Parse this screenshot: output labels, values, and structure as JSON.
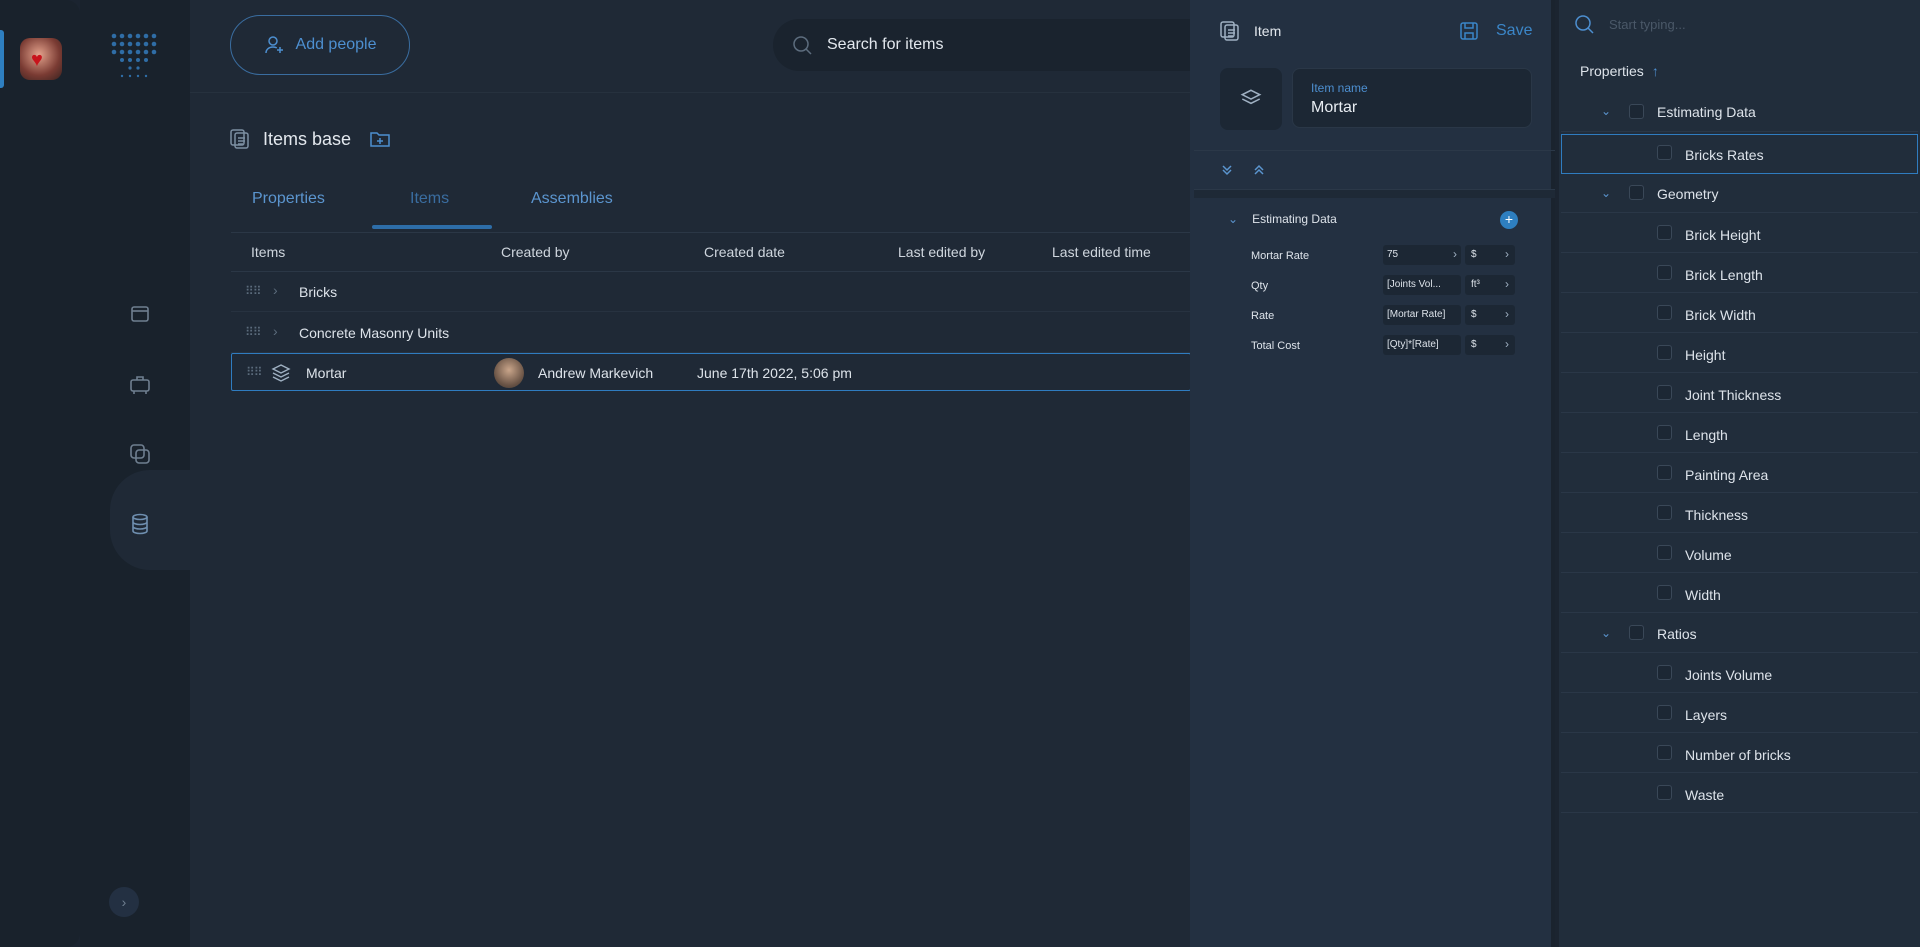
{
  "topbar": {
    "add_people": "Add people",
    "search_placeholder": "Search for items"
  },
  "page": {
    "title": "Items base"
  },
  "tabs": [
    "Properties",
    "Items",
    "Assemblies"
  ],
  "table": {
    "columns": [
      "Items",
      "Created by",
      "Created date",
      "Last edited by",
      "Last edited time"
    ],
    "rows": [
      {
        "name": "Bricks",
        "created_by": "",
        "created_date": ""
      },
      {
        "name": "Concrete Masonry Units",
        "created_by": "",
        "created_date": ""
      },
      {
        "name": "Mortar",
        "created_by": "Andrew Markevich",
        "created_date": "June 17th 2022, 5:06 pm"
      }
    ]
  },
  "item_panel": {
    "title": "Item",
    "save": "Save",
    "name_label": "Item name",
    "name_value": "Mortar",
    "group": "Estimating Data",
    "properties": [
      {
        "label": "Mortar Rate",
        "value": "75",
        "unit": "$"
      },
      {
        "label": "Qty",
        "value": "[Joints Vol...",
        "unit": "ft³"
      },
      {
        "label": "Rate",
        "value": "[Mortar Rate]",
        "unit": "$"
      },
      {
        "label": "Total Cost",
        "value": "[Qty]*[Rate]",
        "unit": "$"
      }
    ]
  },
  "property_tree": {
    "search_placeholder": "Start typing...",
    "title": "Properties",
    "sort_icon": "↑",
    "groups": [
      {
        "name": "Estimating Data",
        "items": [
          "Bricks Rates"
        ]
      },
      {
        "name": "Geometry",
        "items": [
          "Brick Height",
          "Brick Length",
          "Brick Width",
          "Height",
          "Joint Thickness",
          "Length",
          "Painting Area",
          "Thickness",
          "Volume",
          "Width"
        ]
      },
      {
        "name": "Ratios",
        "items": [
          "Joints Volume",
          "Layers",
          "Number of bricks",
          "Waste"
        ]
      }
    ]
  },
  "colors": {
    "accent": "#2e7fc0",
    "background": "#1f2936",
    "panel": "#233041"
  }
}
